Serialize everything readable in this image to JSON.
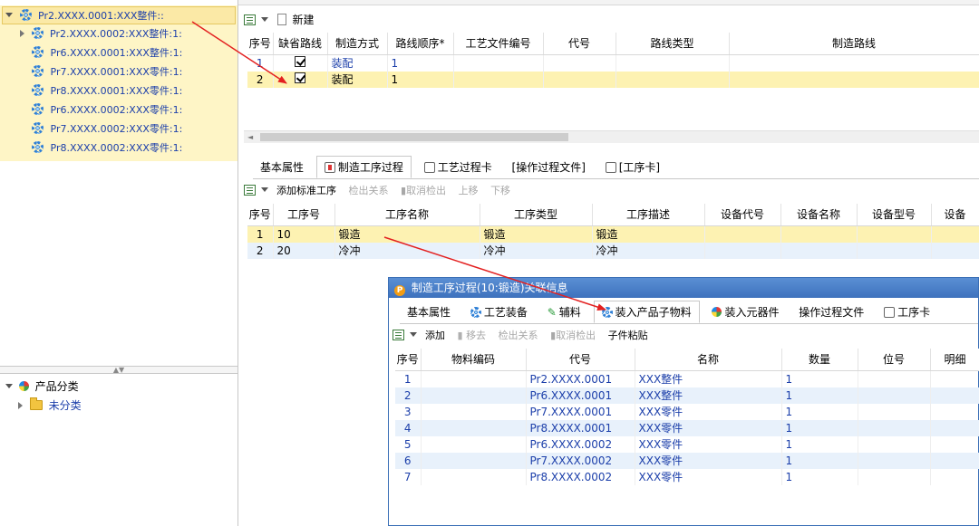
{
  "tree": {
    "root": "Pr2.XXXX.0001:XXX整件::",
    "children": [
      {
        "label": "Pr2.XXXX.0002:XXX整件:1:",
        "expandable": true
      },
      {
        "label": "Pr6.XXXX.0001:XXX整件:1:",
        "expandable": false
      },
      {
        "label": "Pr7.XXXX.0001:XXX零件:1:",
        "expandable": false
      },
      {
        "label": "Pr8.XXXX.0001:XXX零件:1:",
        "expandable": false
      },
      {
        "label": "Pr6.XXXX.0002:XXX零件:1:",
        "expandable": false
      },
      {
        "label": "Pr7.XXXX.0002:XXX零件:1:",
        "expandable": false
      },
      {
        "label": "Pr8.XXXX.0002:XXX零件:1:",
        "expandable": false
      }
    ]
  },
  "category_tree": {
    "root": "产品分类",
    "child": "未分类"
  },
  "route_toolbar": {
    "new_label": "新建"
  },
  "route_table": {
    "headers": [
      "序号",
      "缺省路线",
      "制造方式",
      "路线顺序*",
      "工艺文件编号",
      "代号",
      "路线类型",
      "制造路线"
    ],
    "rows": [
      {
        "no": "1",
        "default": true,
        "method": "装配",
        "order": "1"
      },
      {
        "no": "2",
        "default": true,
        "method": "装配",
        "order": "1"
      }
    ]
  },
  "mid_tabs": [
    "基本属性",
    "制造工序过程",
    "工艺过程卡",
    "[操作过程文件]",
    "[工序卡]"
  ],
  "proc_toolbar": {
    "add": "添加标准工序",
    "checkout_rel": "检出关系",
    "cancel_checkout": "取消检出",
    "up": "上移",
    "down": "下移"
  },
  "proc_table": {
    "headers": [
      "序号",
      "工序号",
      "工序名称",
      "工序类型",
      "工序描述",
      "设备代号",
      "设备名称",
      "设备型号",
      "设备"
    ],
    "rows": [
      {
        "no": "1",
        "code": "10",
        "name": "锻造",
        "type": "锻造",
        "desc": "锻造"
      },
      {
        "no": "2",
        "code": "20",
        "name": "冷冲",
        "type": "冷冲",
        "desc": "冷冲"
      }
    ]
  },
  "dialog": {
    "title": "制造工序过程(10:锻造)关联信息",
    "tabs": [
      "基本属性",
      "工艺装备",
      "辅料",
      "装入产品子物料",
      "装入元器件",
      "操作过程文件",
      "工序卡"
    ],
    "toolbar": {
      "add": "添加",
      "remove": "移去",
      "checkout_rel": "检出关系",
      "cancel_checkout": "取消检出",
      "paste": "子件粘贴"
    },
    "table": {
      "headers": [
        "序号",
        "物料编码",
        "代号",
        "名称",
        "数量",
        "位号",
        "明细"
      ],
      "rows": [
        {
          "no": "1",
          "code": "Pr2.XXXX.0001",
          "name": "XXX整件",
          "qty": "1"
        },
        {
          "no": "2",
          "code": "Pr6.XXXX.0001",
          "name": "XXX整件",
          "qty": "1"
        },
        {
          "no": "3",
          "code": "Pr7.XXXX.0001",
          "name": "XXX零件",
          "qty": "1"
        },
        {
          "no": "4",
          "code": "Pr8.XXXX.0001",
          "name": "XXX零件",
          "qty": "1"
        },
        {
          "no": "5",
          "code": "Pr6.XXXX.0002",
          "name": "XXX零件",
          "qty": "1"
        },
        {
          "no": "6",
          "code": "Pr7.XXXX.0002",
          "name": "XXX零件",
          "qty": "1"
        },
        {
          "no": "7",
          "code": "Pr8.XXXX.0002",
          "name": "XXX零件",
          "qty": "1"
        }
      ]
    }
  },
  "colors": {
    "selection": "#fdf2b2",
    "tree_bg": "#fef5c6",
    "alt_row": "#e8f1fb",
    "link_blue": "#1c3faa",
    "annotation_arrow": "#e32020",
    "dialog_title": "#3e72bd"
  }
}
